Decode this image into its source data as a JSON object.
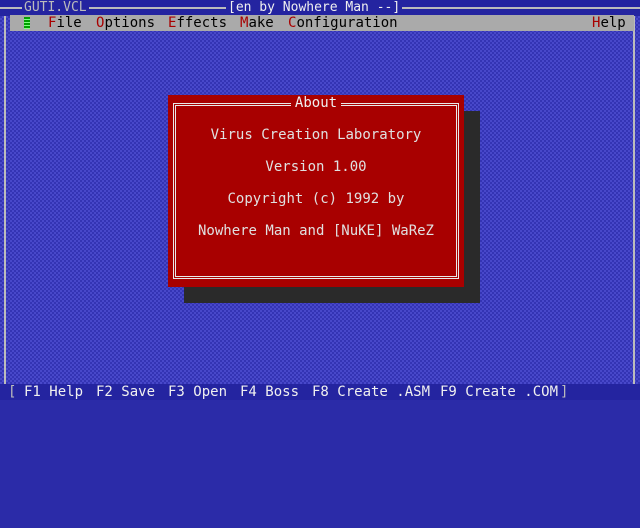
{
  "window": {
    "file_name": "GUTI.VCL",
    "title": "[en by Nowhere Man --]"
  },
  "menubar": {
    "items": [
      {
        "hot": "F",
        "rest": "ile"
      },
      {
        "hot": "O",
        "rest": "ptions"
      },
      {
        "hot": "E",
        "rest": "ffects"
      },
      {
        "hot": "M",
        "rest": "ake"
      },
      {
        "hot": "C",
        "rest": "onfiguration"
      },
      {
        "hot": "H",
        "rest": "elp"
      }
    ]
  },
  "dialog": {
    "title": "About",
    "lines": [
      "Virus Creation Laboratory",
      "Version 1.00",
      "Copyright (c) 1992 by",
      "Nowhere Man and [NuKE] WaReZ"
    ]
  },
  "statusbar": {
    "open_bracket": "[",
    "close_bracket": "]",
    "items": [
      "F1 Help",
      "F2 Save",
      "F3 Open",
      "F4 Boss",
      "F8 Create .ASM",
      "F9 Create .COM"
    ]
  },
  "colors": {
    "desktop": "#3434b4",
    "menubar": "#aaaaaa",
    "menu_hotkey": "#a80000",
    "dialog_bg": "#a80000",
    "statusbar": "#2424a0"
  }
}
